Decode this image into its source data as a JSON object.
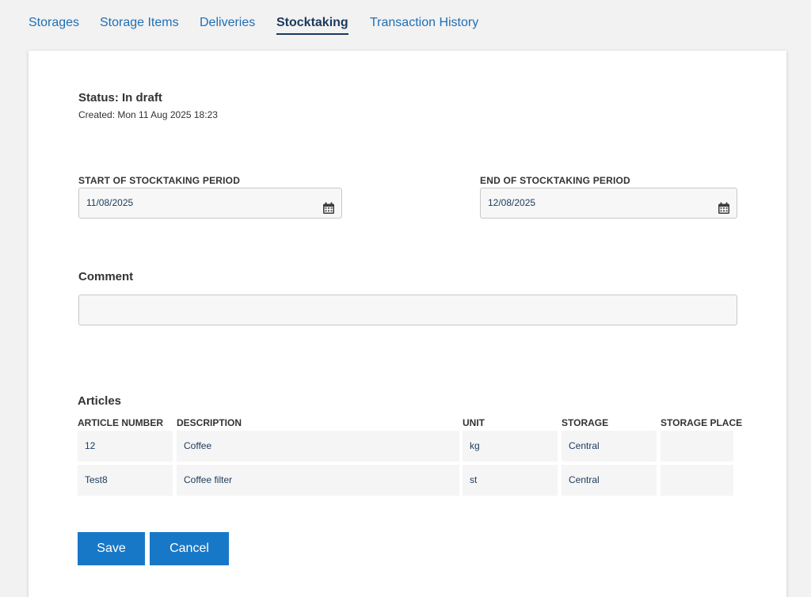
{
  "tabs": [
    {
      "label": "Storages"
    },
    {
      "label": "Storage Items"
    },
    {
      "label": "Deliveries"
    },
    {
      "label": "Stocktaking"
    },
    {
      "label": "Transaction History"
    }
  ],
  "active_tab": "Stocktaking",
  "status": {
    "title": "Status: In draft",
    "created": "Created: Mon 11 Aug 2025 18:23"
  },
  "period": {
    "start_label": "START OF STOCKTAKING PERIOD",
    "start_value": "11/08/2025",
    "end_label": "END OF STOCKTAKING PERIOD",
    "end_value": "12/08/2025"
  },
  "comment": {
    "label": "Comment",
    "value": ""
  },
  "articles": {
    "title": "Articles",
    "columns": [
      "ARTICLE NUMBER",
      "DESCRIPTION",
      "UNIT",
      "STORAGE",
      "STORAGE PLACE"
    ],
    "rows": [
      [
        "12",
        "Coffee",
        "kg",
        "Central",
        ""
      ],
      [
        "Test8",
        "Coffee filter",
        "st",
        "Central",
        ""
      ]
    ]
  },
  "actions": {
    "save_label": "Save",
    "cancel_label": "Cancel"
  },
  "icons": {
    "start_date": "calendar-icon",
    "end_date": "calendar-icon"
  },
  "colors": {
    "link": "#1f6fb5",
    "active_tab": "#1b3a5c",
    "button": "#1878c8"
  }
}
